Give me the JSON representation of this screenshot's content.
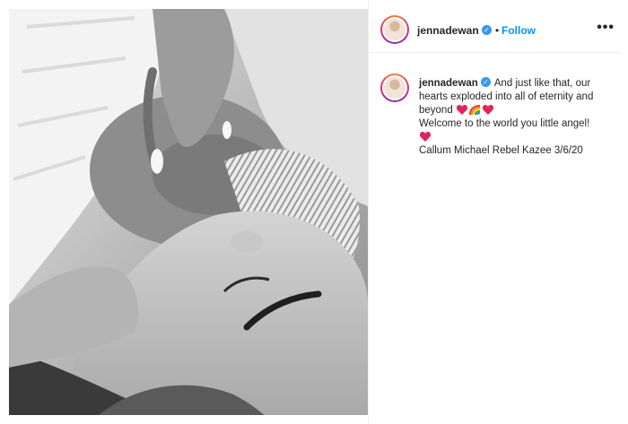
{
  "post": {
    "username": "jennadewan",
    "separator": "•",
    "follow_label": "Follow",
    "more_label": "•••",
    "caption": {
      "username": "jennadewan",
      "line1": "And just like that, our hearts exploded into all of eternity and beyond",
      "line2": "Welcome to the world you little angel!",
      "line3": "Callum Michael Rebel Kazee 3/6/20"
    },
    "icons": {
      "verified": "verified-badge-icon",
      "heart": "red-heart-emoji",
      "rainbow": "rainbow-emoji"
    },
    "colors": {
      "link": "#0095f6",
      "verified": "#3897f0",
      "heart": "#e0245e",
      "text": "#262626"
    }
  }
}
